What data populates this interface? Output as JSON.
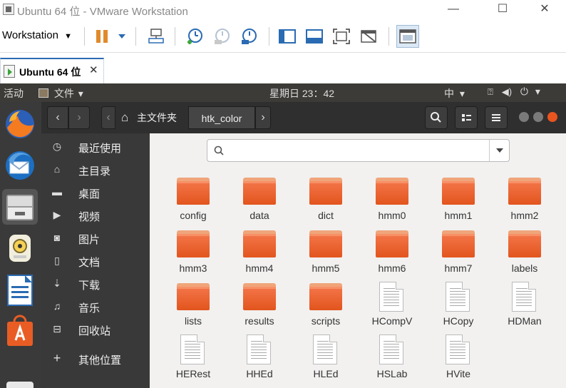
{
  "window": {
    "title": "Ubuntu 64 位 - VMware Workstation",
    "controls": {
      "minimize": "—",
      "maximize": "☐",
      "close": "✕"
    }
  },
  "vmware_toolbar": {
    "menu_label": "Workstation",
    "menu_caret": "▼",
    "accent": "#2a6bb3",
    "pause_color": "#e08a2c"
  },
  "vm_tab": {
    "label": "Ubuntu 64 位",
    "close": "✕"
  },
  "ubuntu_topbar": {
    "activities": "活动",
    "app_menu": "文件",
    "app_menu_caret": "▾",
    "clock": "星期日 23：42",
    "input_method": "中",
    "input_caret": "▾",
    "power_caret": "▾",
    "background": "#3c3b37"
  },
  "dock": {
    "items": [
      {
        "name": "firefox-icon"
      },
      {
        "name": "thunderbird-icon"
      },
      {
        "name": "files-icon",
        "active": true
      },
      {
        "name": "rhythmbox-icon"
      },
      {
        "name": "libreoffice-writer-icon"
      },
      {
        "name": "software-center-icon"
      }
    ]
  },
  "nautilus": {
    "back": "‹",
    "forward": "›",
    "path_left": "‹",
    "path_right": "›",
    "breadcrumbs": [
      {
        "label": "主文件夹",
        "icon": "home-icon"
      },
      {
        "label": "htk_color",
        "current": true
      }
    ],
    "search_input": {
      "value": "",
      "placeholder": ""
    }
  },
  "sidebar": {
    "items": [
      {
        "label": "最近使用",
        "icon": "clock-icon",
        "glyph": "◷"
      },
      {
        "label": "主目录",
        "icon": "home-icon",
        "glyph": "⌂"
      },
      {
        "label": "桌面",
        "icon": "folder-icon",
        "glyph": "▬"
      },
      {
        "label": "视频",
        "icon": "video-icon",
        "glyph": "▶"
      },
      {
        "label": "图片",
        "icon": "camera-icon",
        "glyph": "◙"
      },
      {
        "label": "文档",
        "icon": "document-icon",
        "glyph": "▯"
      },
      {
        "label": "下载",
        "icon": "download-icon",
        "glyph": "⇣"
      },
      {
        "label": "音乐",
        "icon": "music-icon",
        "glyph": "♫"
      },
      {
        "label": "回收站",
        "icon": "trash-icon",
        "glyph": "⊟"
      },
      {
        "label": "其他位置",
        "icon": "plus-icon",
        "glyph": "+"
      }
    ]
  },
  "files": [
    {
      "label": "config",
      "type": "folder"
    },
    {
      "label": "data",
      "type": "folder"
    },
    {
      "label": "dict",
      "type": "folder"
    },
    {
      "label": "hmm0",
      "type": "folder"
    },
    {
      "label": "hmm1",
      "type": "folder"
    },
    {
      "label": "hmm2",
      "type": "folder"
    },
    {
      "label": "hmm3",
      "type": "folder"
    },
    {
      "label": "hmm4",
      "type": "folder"
    },
    {
      "label": "hmm5",
      "type": "folder"
    },
    {
      "label": "hmm6",
      "type": "folder"
    },
    {
      "label": "hmm7",
      "type": "folder"
    },
    {
      "label": "labels",
      "type": "folder"
    },
    {
      "label": "lists",
      "type": "folder"
    },
    {
      "label": "results",
      "type": "folder"
    },
    {
      "label": "scripts",
      "type": "folder"
    },
    {
      "label": "HCompV",
      "type": "file"
    },
    {
      "label": "HCopy",
      "type": "file"
    },
    {
      "label": "HDMan",
      "type": "file"
    },
    {
      "label": "HERest",
      "type": "file"
    },
    {
      "label": "HHEd",
      "type": "file"
    },
    {
      "label": "HLEd",
      "type": "file"
    },
    {
      "label": "HSLab",
      "type": "file"
    },
    {
      "label": "HVite",
      "type": "file"
    }
  ],
  "colors": {
    "folder_orange": "#e95d25",
    "window_close": "#e9541f",
    "window_other": "#7a7a7a"
  }
}
